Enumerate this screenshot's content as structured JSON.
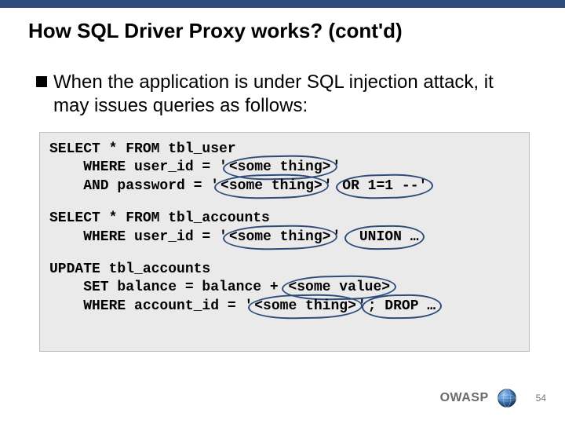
{
  "slide": {
    "title": "How SQL Driver Proxy works? (cont'd)",
    "bullet": "When the application is under SQL injection attack, it may issues queries as follows:",
    "code": {
      "q1": {
        "l1": "SELECT * FROM tbl_user",
        "l2a": "    WHERE user_id = '",
        "l2ph": "<some thing>",
        "l2b": "'",
        "l3a": "    AND password = '",
        "l3ph": "<some thing>",
        "l3b": "' ",
        "l3inj": "OR 1=1 --'"
      },
      "q2": {
        "l1": "SELECT * FROM tbl_accounts",
        "l2a": "    WHERE user_id = '",
        "l2ph": "<some thing>",
        "l2b": "' ",
        "l2inj": " UNION …"
      },
      "q3": {
        "l1": "UPDATE tbl_accounts",
        "l2a": "    SET balance = balance + ",
        "l2ph": "<some value>",
        "l3a": "    WHERE account_id = '",
        "l3ph": "<some thing>",
        "l3b": "'",
        "l3inj": "; DROP …"
      }
    }
  },
  "footer": {
    "org": "OWASP",
    "page": "54"
  }
}
